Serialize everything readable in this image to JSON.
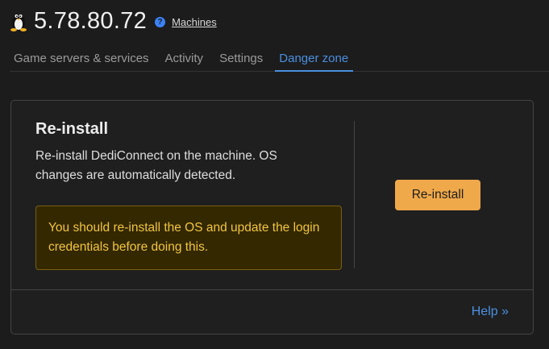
{
  "header": {
    "title": "5.78.80.72",
    "help_icon": "?",
    "machines_link": "Machines"
  },
  "tabs": [
    {
      "label": "Game servers & services",
      "active": false
    },
    {
      "label": "Activity",
      "active": false
    },
    {
      "label": "Settings",
      "active": false
    },
    {
      "label": "Danger zone",
      "active": true
    }
  ],
  "reinstall": {
    "title": "Re-install",
    "description": "Re-install DediConnect on the machine. OS changes are automatically detected.",
    "warning": "You should re-install the OS and update the login credentials before doing this.",
    "button_label": "Re-install",
    "help_link": "Help »"
  },
  "colors": {
    "accent": "#4a8fe0",
    "button": "#f0a94a",
    "warning_bg": "#332800",
    "warning_text": "#f2c443"
  },
  "icons": {
    "os": "linux-tux-icon",
    "help": "question-circle-icon"
  }
}
